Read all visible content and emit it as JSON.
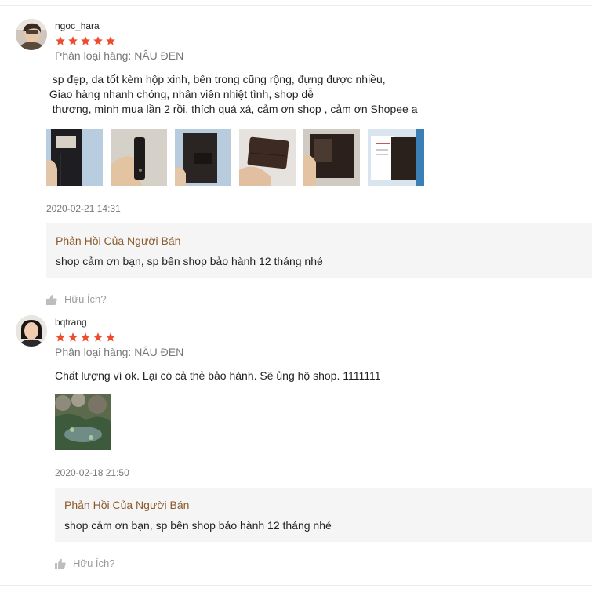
{
  "colors": {
    "star": "#ee4d2d",
    "reply_title": "#8b5a2b",
    "reply_bg": "#f5f5f5"
  },
  "reviews": [
    {
      "username": "ngoc_hara",
      "rating": 5,
      "variation": "Phân loại hàng: NÂU ĐEN",
      "comment": "  sp đẹp, da tốt kèm hộp xinh, bên trong cũng rộng, đựng được nhiều,\n Giao hàng nhanh chóng, nhân viên nhiệt tình, shop dễ\n  thương, mình mua lần 2 rồi, thích quá xá, cảm ơn shop , cảm ơn Shopee ạ",
      "images": [
        "wallet-photo-1",
        "wallet-photo-2",
        "wallet-photo-3",
        "wallet-photo-4",
        "wallet-photo-5",
        "wallet-photo-6"
      ],
      "time": "2020-02-21 14:31",
      "seller_reply": {
        "title": "Phản Hồi Của Người Bán",
        "text": "shop cảm ơn bạn, sp bên shop bảo hành 12 tháng nhé"
      },
      "helpful_label": "Hữu Ích?"
    },
    {
      "username": "bqtrang",
      "rating": 5,
      "variation": "Phân loại hàng: NÂU ĐEN",
      "comment": "Chất lượng ví ok. Lại có cả thẻ bảo hành. Sẽ ủng hộ shop. 1111111",
      "images": [
        "garden-photo"
      ],
      "time": "2020-02-18 21:50",
      "seller_reply": {
        "title": "Phản Hồi Của Người Bán",
        "text": "shop cảm ơn bạn, sp bên shop bảo hành 12 tháng nhé"
      },
      "helpful_label": "Hữu Ích?"
    }
  ]
}
